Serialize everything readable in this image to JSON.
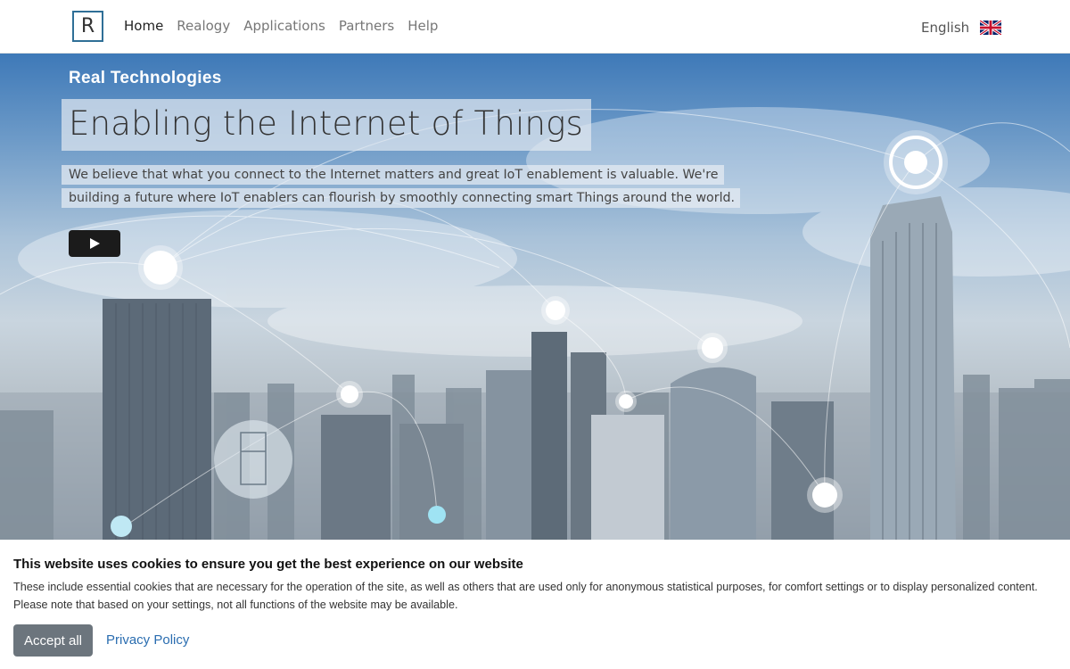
{
  "nav": {
    "logo_letter": "R",
    "links": [
      "Home",
      "Realogy",
      "Applications",
      "Partners",
      "Help"
    ],
    "active_link": "Home",
    "language": "English",
    "flag_icon": "uk-flag-icon"
  },
  "hero": {
    "company": "Real Technologies",
    "title": "Enabling the Internet of Things",
    "text": "We believe that what you connect to the Internet matters and great IoT enablement is valuable. We're building a future where IoT enablers can flourish by smoothly connecting smart Things around the world.",
    "play_icon": "play-icon"
  },
  "cookie": {
    "title": "This website uses cookies to ensure you get the best experience on our website",
    "text": "These include essential cookies that are necessary for the operation of the site, as well as others that are used only for anonymous statistical purposes, for comfort settings or to display personalized content. Please note that based on your settings, not all functions of the website may be available.",
    "accept_label": "Accept all",
    "privacy_label": "Privacy Policy"
  },
  "colors": {
    "logo_border": "#2f6f97",
    "accept_button": "#6c757d",
    "link": "#2a6db0"
  }
}
